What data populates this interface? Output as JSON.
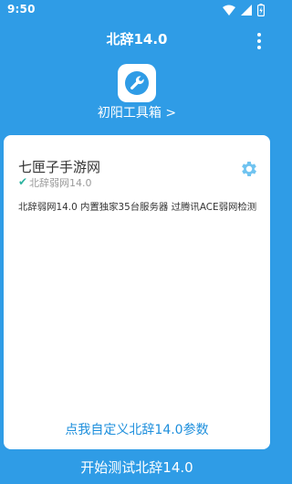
{
  "status_bar": {
    "time": "9:50",
    "icons": [
      "wifi-icon",
      "signal-icon",
      "battery-icon"
    ]
  },
  "app_bar": {
    "title": "北辞14.0",
    "menu_icon": "more-vert-icon"
  },
  "toolbox": {
    "icon": "wrench-icon",
    "link_label": "初阳工具箱 >"
  },
  "card": {
    "app_name": "七匣子手游网",
    "check_mark": "✔",
    "subtitle": "北辞弱网14.0",
    "settings_icon": "gear-icon",
    "description": "北辞弱网14.0 内置独家35台服务器 过腾讯ACE弱网检测",
    "custom_params_label": "点我自定义北辞14.0参数"
  },
  "start_button": {
    "label": "开始测试北辞14.0"
  },
  "colors": {
    "primary": "#2f9ce6",
    "link_blue": "#1e8fdc",
    "check_green": "#2db3a0",
    "gear_blue": "#6fc3f0"
  }
}
